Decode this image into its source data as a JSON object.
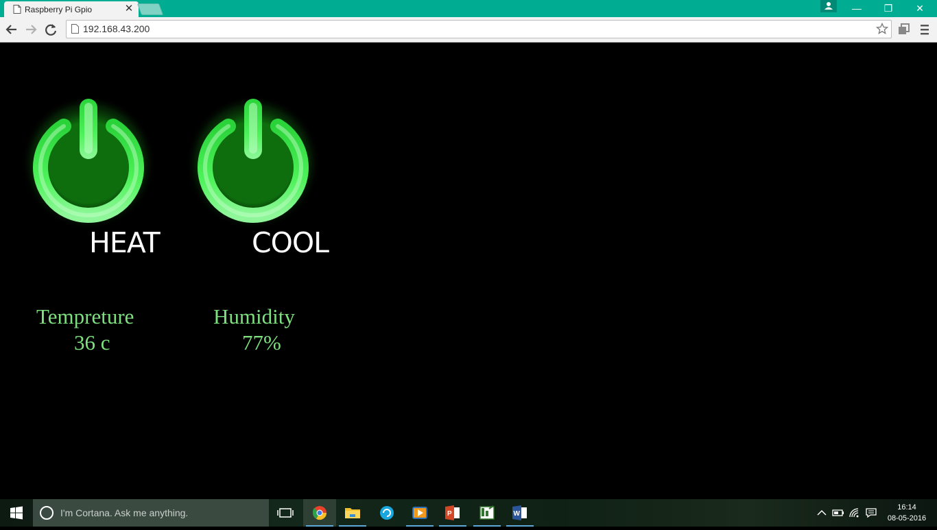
{
  "browser": {
    "tab_title": "Raspberry Pi Gpio",
    "tab_close": "✕",
    "url": "192.168.43.200",
    "window_controls": {
      "minimize": "—",
      "restore": "❐",
      "close": "✕"
    }
  },
  "page": {
    "buttons": [
      {
        "label": "HEAT",
        "icon": "power-icon",
        "state": "on",
        "color": "#4ef25a"
      },
      {
        "label": "COOL",
        "icon": "power-icon",
        "state": "on",
        "color": "#4ef25a"
      }
    ],
    "sensors": [
      {
        "label": "Tempreture",
        "value": "36 c"
      },
      {
        "label": "Humidity",
        "value": "77%"
      }
    ],
    "accent_color": "#7ee07f"
  },
  "taskbar": {
    "cortana_placeholder": "I'm Cortana. Ask me anything.",
    "apps": [
      "chrome-icon",
      "file-explorer-icon",
      "store-icon",
      "video-icon",
      "powerpoint-icon",
      "project-icon",
      "word-icon"
    ],
    "time": "16:14",
    "date": "08-05-2016"
  }
}
